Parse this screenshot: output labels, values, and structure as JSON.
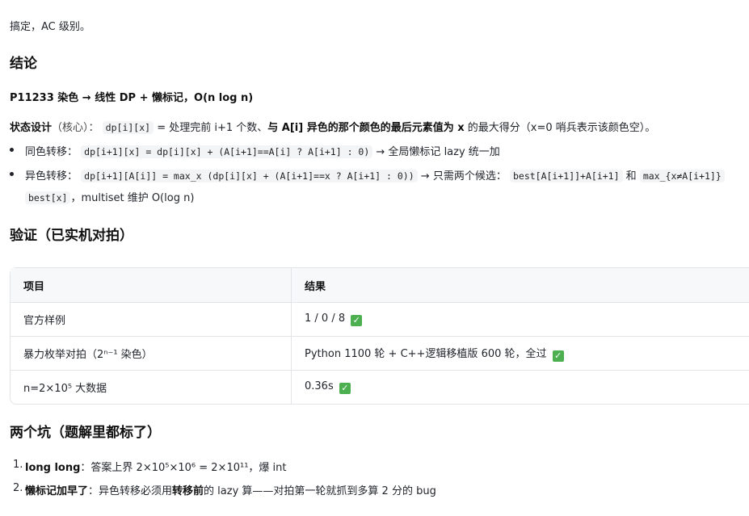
{
  "intro": "搞定，AC 级别。",
  "conclusion": {
    "heading": "结论",
    "problem_line": "P11233 染色 → 线性 DP + 懒标记，O(n log n)",
    "state_label": "状态设计",
    "state_note": "（核心）：",
    "state_code": "dp[i][x]",
    "state_mid": "= 处理完前 i+1 个数、",
    "state_bold": "与 A[i] 异色的那个颜色的最后元素值为 x",
    "state_tail": "的最大得分（x=0 哨兵表示该颜色空）。",
    "bullet1_label": "同色转移：",
    "bullet1_code": "dp[i+1][x] = dp[i][x] + (A[i+1]==A[i] ? A[i+1] : 0)",
    "bullet1_tail": "→ 全局懒标记 lazy 统一加",
    "bullet2_label": "异色转移：",
    "bullet2_code": "dp[i+1][A[i]] = max_x (dp[i][x] + (A[i+1]==x ? A[i+1] : 0))",
    "bullet2_mid": "→ 只需两个候选：",
    "bullet2_code2": "best[A[i+1]]+A[i+1]",
    "bullet2_and": "和",
    "bullet2_code3": "max_{x≠A[i+1]}",
    "bullet2_code4": "best[x]",
    "bullet2_tail": "，multiset 维护 O(log n)"
  },
  "verify": {
    "heading": "验证（已实机对拍）",
    "col_item": "项目",
    "col_result": "结果",
    "rows": [
      {
        "item": "官方样例",
        "result": "1 / 0 / 8"
      },
      {
        "item": "暴力枚举对拍（2ⁿ⁻¹ 染色）",
        "result": "Python 1100 轮 + C++逻辑移植版 600 轮，全过"
      },
      {
        "item": "n=2×10⁵ 大数据",
        "result": "0.36s"
      }
    ],
    "check_icon": "✓"
  },
  "pits": {
    "heading": "两个坑（题解里都标了）",
    "item1_num": "1.",
    "item1_bold": "long long",
    "item1_text": "：答案上界 2×10⁵×10⁶ = 2×10¹¹，爆 int",
    "item2_num": "2.",
    "item2_bold": "懒标记加早了",
    "item2_text_a": "：异色转移必须用",
    "item2_bold2": "转移前",
    "item2_text_b": "的 lazy 算——对拍第一轮就抓到多算 2 分的 bug"
  }
}
